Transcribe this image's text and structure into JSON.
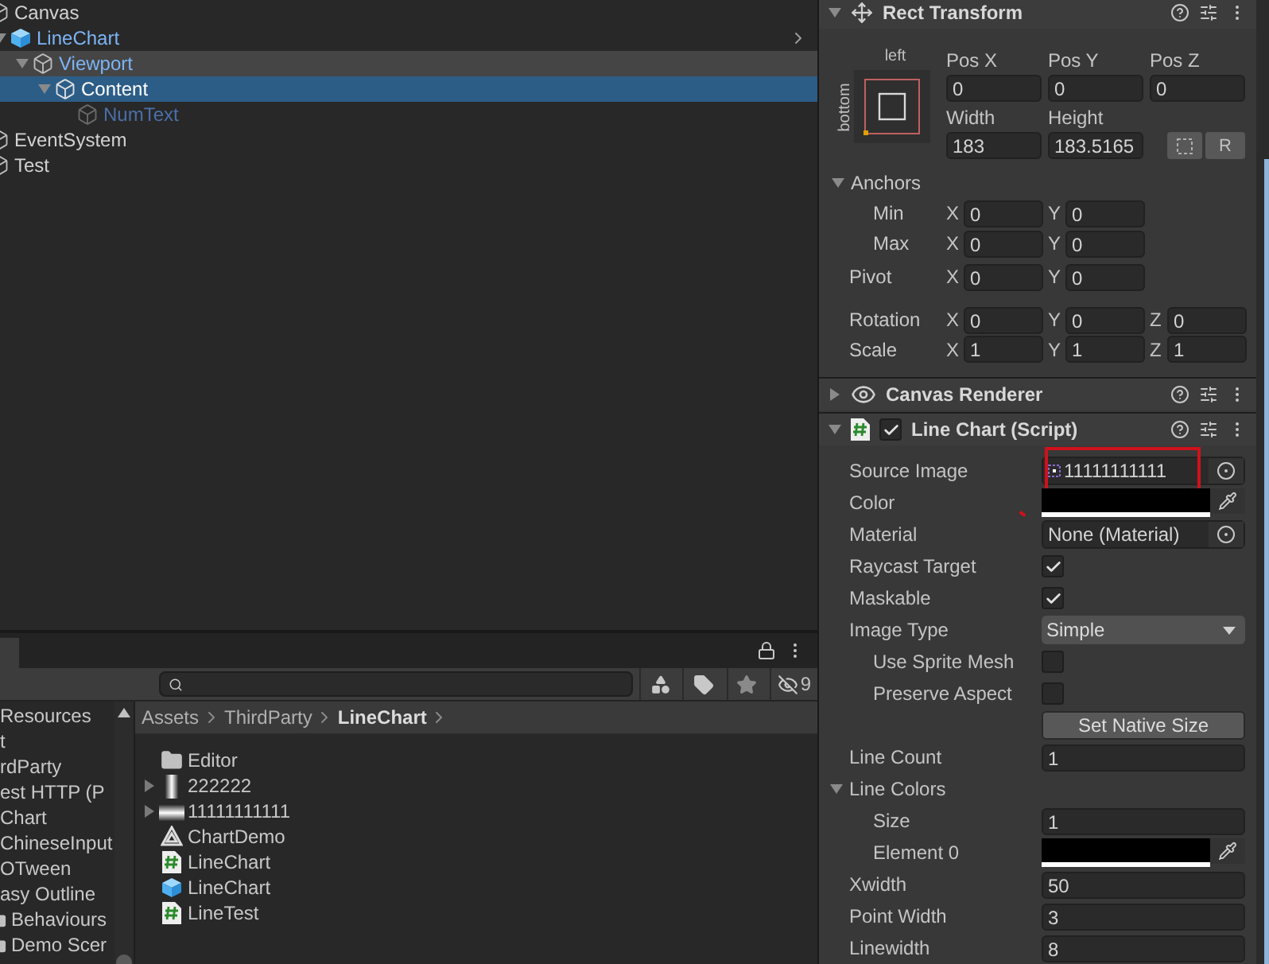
{
  "hierarchy": {
    "items": [
      {
        "name": "Canvas",
        "kind": "object",
        "selected": false,
        "highlighted": false,
        "children": [
          {
            "name": "LineChart",
            "kind": "prefab-root",
            "expanded": true,
            "selected": false,
            "highlighted": false,
            "children": [
              {
                "name": "Viewport",
                "kind": "prefab",
                "expanded": true,
                "selected": false,
                "highlighted": true,
                "children": [
                  {
                    "name": "Content",
                    "kind": "prefab",
                    "expanded": true,
                    "selected": true,
                    "highlighted": false,
                    "children": [
                      {
                        "name": "NumText",
                        "kind": "prefab-inactive",
                        "selected": false,
                        "highlighted": false
                      }
                    ]
                  }
                ]
              }
            ]
          }
        ]
      },
      {
        "name": "EventSystem",
        "kind": "object",
        "selected": false,
        "highlighted": false
      },
      {
        "name": "Test",
        "kind": "object",
        "selected": false,
        "highlighted": false
      }
    ]
  },
  "project": {
    "filters": [
      {
        "kind": "type"
      },
      {
        "kind": "label"
      },
      {
        "kind": "favorite"
      },
      {
        "kind": "hidden",
        "count": "9"
      }
    ],
    "tree": [
      {
        "name": "Resources",
        "kind": "label"
      },
      {
        "name": "t",
        "kind": "label"
      },
      {
        "name": "rdParty",
        "kind": "label"
      },
      {
        "name": "est HTTP (P",
        "kind": "label"
      },
      {
        "name": "Chart",
        "kind": "label"
      },
      {
        "name": "ChineseInput",
        "kind": "label"
      },
      {
        "name": "OTween",
        "kind": "label"
      },
      {
        "name": "asy Outline",
        "kind": "label"
      },
      {
        "name": "Behaviours",
        "kind": "folder"
      },
      {
        "name": "Demo Scer",
        "kind": "folder"
      }
    ],
    "breadcrumb": [
      {
        "name": "Assets",
        "selected": false
      },
      {
        "name": "ThirdParty",
        "selected": false
      },
      {
        "name": "LineChart",
        "selected": true
      }
    ],
    "files": [
      {
        "name": "Editor",
        "kind": "folder",
        "expandable": false
      },
      {
        "name": "222222",
        "kind": "texture-vertical",
        "expandable": true
      },
      {
        "name": "11111111111",
        "kind": "texture-horizontal",
        "expandable": true
      },
      {
        "name": "ChartDemo",
        "kind": "scene",
        "expandable": false
      },
      {
        "name": "LineChart",
        "kind": "script",
        "expandable": false
      },
      {
        "name": "LineChart",
        "kind": "prefab",
        "expandable": false
      },
      {
        "name": "LineTest",
        "kind": "script",
        "expandable": false
      }
    ]
  },
  "inspector": {
    "rect_transform": {
      "title": "Rect Transform",
      "anchor_top_label": "left",
      "anchor_side_label": "bottom",
      "position": [
        {
          "label": "Pos X",
          "value": "0"
        },
        {
          "label": "Pos Y",
          "value": "0"
        },
        {
          "label": "Pos Z",
          "value": "0"
        }
      ],
      "size": [
        {
          "label": "Width",
          "value": "183"
        },
        {
          "label": "Height",
          "value": "183.5165"
        }
      ],
      "raw_button": "R",
      "anchors": {
        "label": "Anchors",
        "expanded": true,
        "children": [
          {
            "label": "Min",
            "fields": [
              {
                "axis": "X",
                "value": "0"
              },
              {
                "axis": "Y",
                "value": "0"
              }
            ]
          },
          {
            "label": "Max",
            "fields": [
              {
                "axis": "X",
                "value": "0"
              },
              {
                "axis": "Y",
                "value": "0"
              }
            ]
          }
        ]
      },
      "vectors": [
        {
          "label": "Pivot",
          "fields": [
            {
              "axis": "X",
              "value": "0"
            },
            {
              "axis": "Y",
              "value": "0"
            }
          ]
        },
        {
          "label": "Rotation",
          "fields": [
            {
              "axis": "X",
              "value": "0"
            },
            {
              "axis": "Y",
              "value": "0"
            },
            {
              "axis": "Z",
              "value": "0"
            }
          ]
        },
        {
          "label": "Scale",
          "fields": [
            {
              "axis": "X",
              "value": "1"
            },
            {
              "axis": "Y",
              "value": "1"
            },
            {
              "axis": "Z",
              "value": "1"
            }
          ]
        }
      ]
    },
    "components": [
      {
        "title": "Canvas Renderer",
        "kind": "renderer",
        "expanded": false
      },
      {
        "title": "Line Chart (Script)",
        "kind": "script",
        "expanded": true,
        "enabled": true
      }
    ],
    "properties": [
      {
        "label": "Source Image",
        "kind": "object",
        "value": "11111111111",
        "sprite": true
      },
      {
        "label": "Color",
        "kind": "color",
        "color": "#000000"
      },
      {
        "label": "Material",
        "kind": "object",
        "value": "None (Material)",
        "sprite": false
      },
      {
        "label": "Raycast Target",
        "kind": "checkbox",
        "checked": true
      },
      {
        "label": "Maskable",
        "kind": "checkbox",
        "checked": true
      },
      {
        "label": "Image Type",
        "kind": "dropdown",
        "value": "Simple",
        "children": [
          {
            "label": "Use Sprite Mesh",
            "kind": "checkbox",
            "checked": false
          },
          {
            "label": "Preserve Aspect",
            "kind": "checkbox",
            "checked": false
          }
        ]
      },
      {
        "label": "Set Native Size",
        "kind": "button"
      },
      {
        "label": "Line Count",
        "kind": "text",
        "value": "1"
      },
      {
        "label": "Line Colors",
        "kind": "foldout",
        "expanded": true,
        "children": [
          {
            "label": "Size",
            "kind": "text",
            "value": "1"
          },
          {
            "label": "Element 0",
            "kind": "color",
            "color": "#000000"
          }
        ]
      },
      {
        "label": "Xwidth",
        "kind": "text",
        "value": "50"
      },
      {
        "label": "Point Width",
        "kind": "text",
        "value": "3"
      },
      {
        "label": "Linewidth",
        "kind": "text",
        "value": "8"
      }
    ]
  }
}
